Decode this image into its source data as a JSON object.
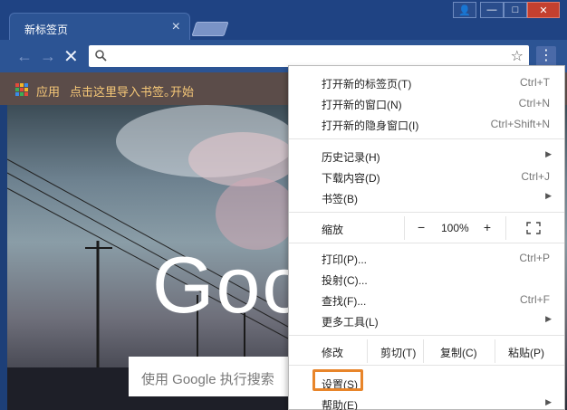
{
  "tab": {
    "title": "新标签页",
    "close": "×"
  },
  "window": {
    "user": "👤",
    "minimize": "—",
    "maximize": "□",
    "close": "✕"
  },
  "toolbar": {
    "back": "←",
    "forward": "→",
    "stop": "✕",
    "omnibox_value": "",
    "star": "☆",
    "menu": "⋮"
  },
  "bookmarks": {
    "apps": "应用",
    "import": "点击这里导入书签。",
    "start": "开始"
  },
  "page": {
    "logo": "Goo",
    "search_placeholder": "使用 Google 执行搜索"
  },
  "menu": {
    "new_tab": {
      "label": "打开新的标签页(T)",
      "shortcut": "Ctrl+T"
    },
    "new_window": {
      "label": "打开新的窗口(N)",
      "shortcut": "Ctrl+N"
    },
    "incognito": {
      "label": "打开新的隐身窗口(I)",
      "shortcut": "Ctrl+Shift+N"
    },
    "history": {
      "label": "历史记录(H)",
      "arrow": "▶"
    },
    "downloads": {
      "label": "下载内容(D)",
      "shortcut": "Ctrl+J"
    },
    "bookmarks": {
      "label": "书签(B)",
      "arrow": "▶"
    },
    "zoom": {
      "label": "缩放",
      "minus": "−",
      "value": "100%",
      "plus": "+"
    },
    "print": {
      "label": "打印(P)...",
      "shortcut": "Ctrl+P"
    },
    "cast": {
      "label": "投射(C)..."
    },
    "find": {
      "label": "查找(F)...",
      "shortcut": "Ctrl+F"
    },
    "more_tools": {
      "label": "更多工具(L)",
      "arrow": "▶"
    },
    "edit": {
      "label": "修改",
      "cut": "剪切(T)",
      "copy": "复制(C)",
      "paste": "粘贴(P)"
    },
    "settings": {
      "label": "设置(S)"
    },
    "help": {
      "label": "帮助(E)",
      "arrow": "▶"
    }
  },
  "colors": {
    "accent_highlight": "#e8852a",
    "frame": "#1f4383",
    "bookmark_text": "#f6c878"
  }
}
